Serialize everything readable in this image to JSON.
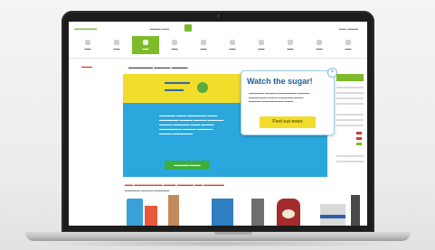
{
  "modal": {
    "title": "Watch the sugar!",
    "close_label": "×",
    "button_label": "Find out more"
  }
}
